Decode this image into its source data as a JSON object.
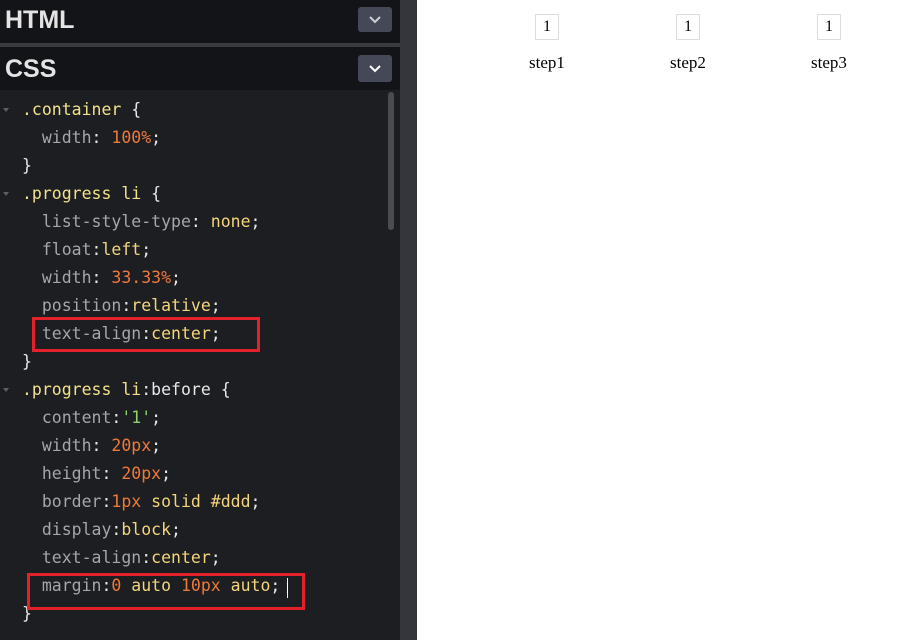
{
  "editor": {
    "html_panel": {
      "title": "HTML"
    },
    "css_panel": {
      "title": "CSS"
    },
    "code_lines": [
      {
        "fold": true,
        "tokens": [
          {
            "t": "sel",
            "v": ".container"
          },
          {
            "t": "punc",
            "v": " {"
          }
        ]
      },
      {
        "fold": false,
        "tokens": [
          {
            "t": "punc",
            "v": "  "
          },
          {
            "t": "prop",
            "v": "width"
          },
          {
            "t": "punc",
            "v": ": "
          },
          {
            "t": "num",
            "v": "100%"
          },
          {
            "t": "punc",
            "v": ";"
          }
        ]
      },
      {
        "fold": false,
        "tokens": [
          {
            "t": "punc",
            "v": "}"
          }
        ]
      },
      {
        "fold": true,
        "tokens": [
          {
            "t": "sel",
            "v": ".progress li"
          },
          {
            "t": "punc",
            "v": " {"
          }
        ]
      },
      {
        "fold": false,
        "tokens": [
          {
            "t": "punc",
            "v": "  "
          },
          {
            "t": "prop",
            "v": "list-style-type"
          },
          {
            "t": "punc",
            "v": ": "
          },
          {
            "t": "kw",
            "v": "none"
          },
          {
            "t": "punc",
            "v": ";"
          }
        ]
      },
      {
        "fold": false,
        "tokens": [
          {
            "t": "punc",
            "v": "  "
          },
          {
            "t": "prop",
            "v": "float"
          },
          {
            "t": "punc",
            "v": ":"
          },
          {
            "t": "kw",
            "v": "left"
          },
          {
            "t": "punc",
            "v": ";"
          }
        ]
      },
      {
        "fold": false,
        "tokens": [
          {
            "t": "punc",
            "v": "  "
          },
          {
            "t": "prop",
            "v": "width"
          },
          {
            "t": "punc",
            "v": ": "
          },
          {
            "t": "num",
            "v": "33.33%"
          },
          {
            "t": "punc",
            "v": ";"
          }
        ]
      },
      {
        "fold": false,
        "tokens": [
          {
            "t": "punc",
            "v": "  "
          },
          {
            "t": "prop",
            "v": "position"
          },
          {
            "t": "punc",
            "v": ":"
          },
          {
            "t": "kw",
            "v": "relative"
          },
          {
            "t": "punc",
            "v": ";"
          }
        ]
      },
      {
        "fold": false,
        "tokens": [
          {
            "t": "punc",
            "v": "  "
          },
          {
            "t": "prop",
            "v": "text-align"
          },
          {
            "t": "punc",
            "v": ":"
          },
          {
            "t": "kw",
            "v": "center"
          },
          {
            "t": "punc",
            "v": ";"
          }
        ]
      },
      {
        "fold": false,
        "tokens": [
          {
            "t": "punc",
            "v": "}"
          }
        ]
      },
      {
        "fold": true,
        "tokens": [
          {
            "t": "sel",
            "v": ".progress li"
          },
          {
            "t": "punc",
            "v": ":before {"
          }
        ]
      },
      {
        "fold": false,
        "tokens": [
          {
            "t": "punc",
            "v": "  "
          },
          {
            "t": "prop",
            "v": "content"
          },
          {
            "t": "punc",
            "v": ":"
          },
          {
            "t": "str",
            "v": "'1'"
          },
          {
            "t": "punc",
            "v": ";"
          }
        ]
      },
      {
        "fold": false,
        "tokens": [
          {
            "t": "punc",
            "v": "  "
          },
          {
            "t": "prop",
            "v": "width"
          },
          {
            "t": "punc",
            "v": ": "
          },
          {
            "t": "num",
            "v": "20px"
          },
          {
            "t": "punc",
            "v": ";"
          }
        ]
      },
      {
        "fold": false,
        "tokens": [
          {
            "t": "punc",
            "v": "  "
          },
          {
            "t": "prop",
            "v": "height"
          },
          {
            "t": "punc",
            "v": ": "
          },
          {
            "t": "num",
            "v": "20px"
          },
          {
            "t": "punc",
            "v": ";"
          }
        ]
      },
      {
        "fold": false,
        "tokens": [
          {
            "t": "punc",
            "v": "  "
          },
          {
            "t": "prop",
            "v": "border"
          },
          {
            "t": "punc",
            "v": ":"
          },
          {
            "t": "num",
            "v": "1px"
          },
          {
            "t": "kw",
            "v": " solid #ddd"
          },
          {
            "t": "punc",
            "v": ";"
          }
        ]
      },
      {
        "fold": false,
        "tokens": [
          {
            "t": "punc",
            "v": "  "
          },
          {
            "t": "prop",
            "v": "display"
          },
          {
            "t": "punc",
            "v": ":"
          },
          {
            "t": "kw",
            "v": "block"
          },
          {
            "t": "punc",
            "v": ";"
          }
        ]
      },
      {
        "fold": false,
        "tokens": [
          {
            "t": "punc",
            "v": "  "
          },
          {
            "t": "prop",
            "v": "text-align"
          },
          {
            "t": "punc",
            "v": ":"
          },
          {
            "t": "kw",
            "v": "center"
          },
          {
            "t": "punc",
            "v": ";"
          }
        ]
      },
      {
        "fold": false,
        "tokens": [
          {
            "t": "punc",
            "v": "  "
          },
          {
            "t": "prop",
            "v": "margin"
          },
          {
            "t": "punc",
            "v": ":"
          },
          {
            "t": "num",
            "v": "0"
          },
          {
            "t": "kw",
            "v": " auto "
          },
          {
            "t": "num",
            "v": "10px"
          },
          {
            "t": "kw",
            "v": " auto"
          },
          {
            "t": "punc",
            "v": ";"
          }
        ]
      },
      {
        "fold": false,
        "tokens": [
          {
            "t": "punc",
            "v": "}"
          }
        ]
      }
    ]
  },
  "preview": {
    "steps": [
      {
        "number": "1",
        "label": "step1"
      },
      {
        "number": "1",
        "label": "step2"
      },
      {
        "number": "1",
        "label": "step3"
      }
    ]
  },
  "colors": {
    "editor_bg": "#1d1e22",
    "header_bg": "#131417",
    "highlight": "#e3212b",
    "step_border": "#dddddd"
  }
}
